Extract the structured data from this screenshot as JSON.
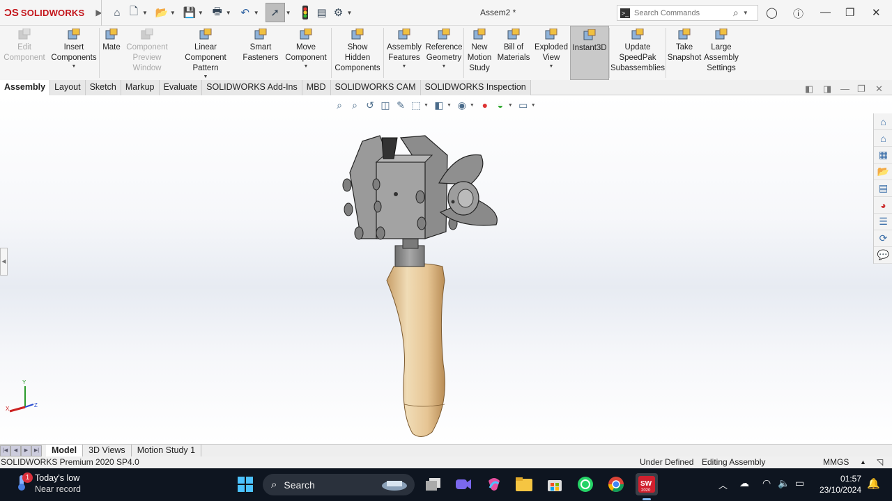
{
  "app": {
    "brand": "SOLIDWORKS",
    "document_title": "Assem2 *"
  },
  "search": {
    "placeholder": "Search Commands"
  },
  "ribbon": [
    {
      "label": "Edit\nComponent",
      "icon": "edit-component-icon",
      "disabled": true
    },
    {
      "label": "Insert\nComponents",
      "icon": "insert-components-icon",
      "caret": true
    },
    {
      "label": "Mate",
      "icon": "mate-paperclip-icon"
    },
    {
      "label": "Component\nPreview\nWindow",
      "icon": "preview-window-icon",
      "disabled": true
    },
    {
      "label": "Linear Component\nPattern",
      "icon": "pattern-icon",
      "caret": true
    },
    {
      "label": "Smart\nFasteners",
      "icon": "smart-fasteners-icon"
    },
    {
      "label": "Move\nComponent",
      "icon": "move-component-icon",
      "caret": true
    },
    {
      "label": "Show\nHidden\nComponents",
      "icon": "show-hidden-icon"
    },
    {
      "label": "Assembly\nFeatures",
      "icon": "assembly-features-icon",
      "caret": true
    },
    {
      "label": "Reference\nGeometry",
      "icon": "reference-geometry-icon",
      "caret": true
    },
    {
      "label": "New\nMotion\nStudy",
      "icon": "motion-study-icon"
    },
    {
      "label": "Bill of\nMaterials",
      "icon": "bom-icon"
    },
    {
      "label": "Exploded\nView",
      "icon": "exploded-view-icon",
      "caret": true
    },
    {
      "label": "Instant3D",
      "icon": "instant3d-icon",
      "active": true
    },
    {
      "label": "Update\nSpeedPak\nSubassemblies",
      "icon": "speedpak-icon"
    },
    {
      "label": "Take\nSnapshot",
      "icon": "camera-icon"
    },
    {
      "label": "Large\nAssembly\nSettings",
      "icon": "large-assembly-icon"
    }
  ],
  "tabs": [
    "Assembly",
    "Layout",
    "Sketch",
    "Markup",
    "Evaluate",
    "SOLIDWORKS Add-Ins",
    "MBD",
    "SOLIDWORKS CAM",
    "SOLIDWORKS Inspection"
  ],
  "active_tab": "Assembly",
  "bottom_tabs": [
    "Model",
    "3D Views",
    "Motion Study 1"
  ],
  "active_bottom_tab": "Model",
  "triad": {
    "x": "X",
    "y": "Y",
    "z": "Z"
  },
  "status": {
    "product": "SOLIDWORKS Premium 2020 SP4.0",
    "definition": "Under Defined",
    "mode": "Editing Assembly",
    "units": "MMGS"
  },
  "taskbar": {
    "weather_title": "Today's low",
    "weather_sub": "Near record",
    "weather_badge": "1",
    "search_label": "Search",
    "sw_badge": "2020",
    "time": "01:57",
    "date": "23/10/2024"
  },
  "colors": {
    "brand_red": "#c4161c",
    "ribbon_bg": "#f5f5f5",
    "taskbar_bg": "#0e1520",
    "wood": "#e5c79a",
    "metal": "#8a8a8a"
  }
}
